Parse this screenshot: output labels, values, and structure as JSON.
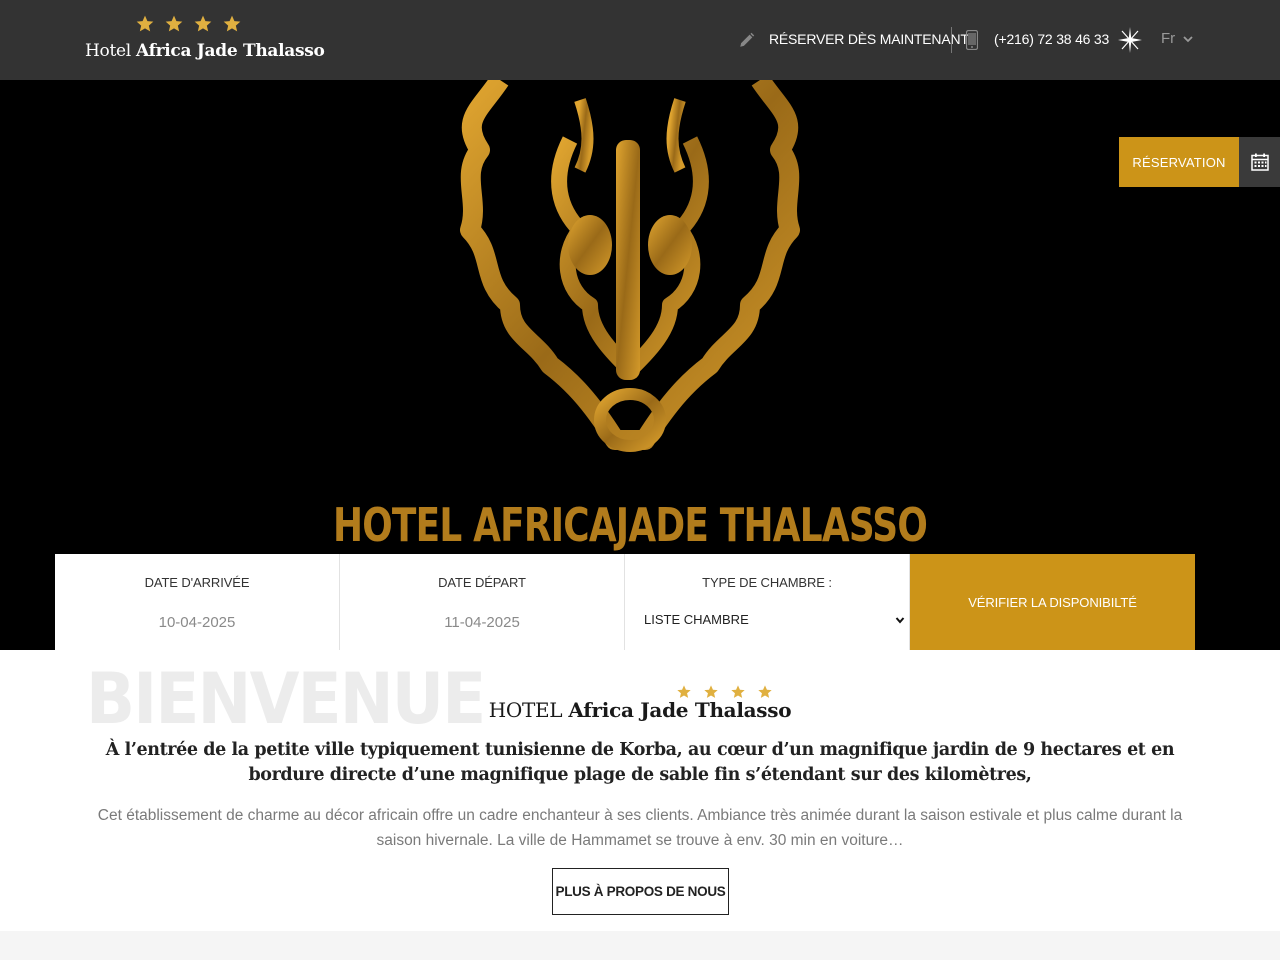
{
  "header": {
    "brand_prefix": "Hotel",
    "brand_name": "Africa Jade Thalasso",
    "star_count": 4,
    "reserve_label": "RÉSERVER DÈS MAINTENANT",
    "phone": "(+216) 72 38 46 33",
    "language": "Fr",
    "icons": [
      "pencil-icon",
      "phone-icon",
      "compass-icon",
      "chevron-down-icon"
    ]
  },
  "hero": {
    "logo_text": "HOTEL AFRICAJADE THALASSO",
    "reservation_tab_label": "RÉSERVATION",
    "reservation_tab_icon": "calendar-icon"
  },
  "booking": {
    "arrival_label": "DATE D'ARRIVÉE",
    "arrival_value": "10-04-2025",
    "departure_label": "DATE DÉPART",
    "departure_value": "11-04-2025",
    "room_type_label": "TYPE DE CHAMBRE :",
    "room_type_value": "LISTE CHAMBRE",
    "submit_label": "VÉRIFIER LA DISPONIBILTÉ"
  },
  "welcome": {
    "watermark": "BIENVENUE",
    "title_prefix": "HOTEL",
    "title_name": "Africa Jade Thalasso",
    "lead": "À l’entrée de la petite ville typiquement tunisienne de Korba, au cœur d’un magnifique jardin de 9 hectares et en bordure directe d’une magnifique plage de sable fin s’étendant sur des kilomètres,",
    "body": "Cet établissement de charme au décor africain offre un cadre enchanteur à ses clients. Ambiance très animée durant la saison estivale et plus calme durant la saison hivernale. La ville de Hammamet se trouve à env. 30 min en voiture…",
    "button_label": "PLUS À PROPOS DE NOUS"
  },
  "colors": {
    "header_bg": "#333333",
    "accent_gold": "#cc9418",
    "star_gold": "#e0b040",
    "hero_bg": "#000000"
  }
}
